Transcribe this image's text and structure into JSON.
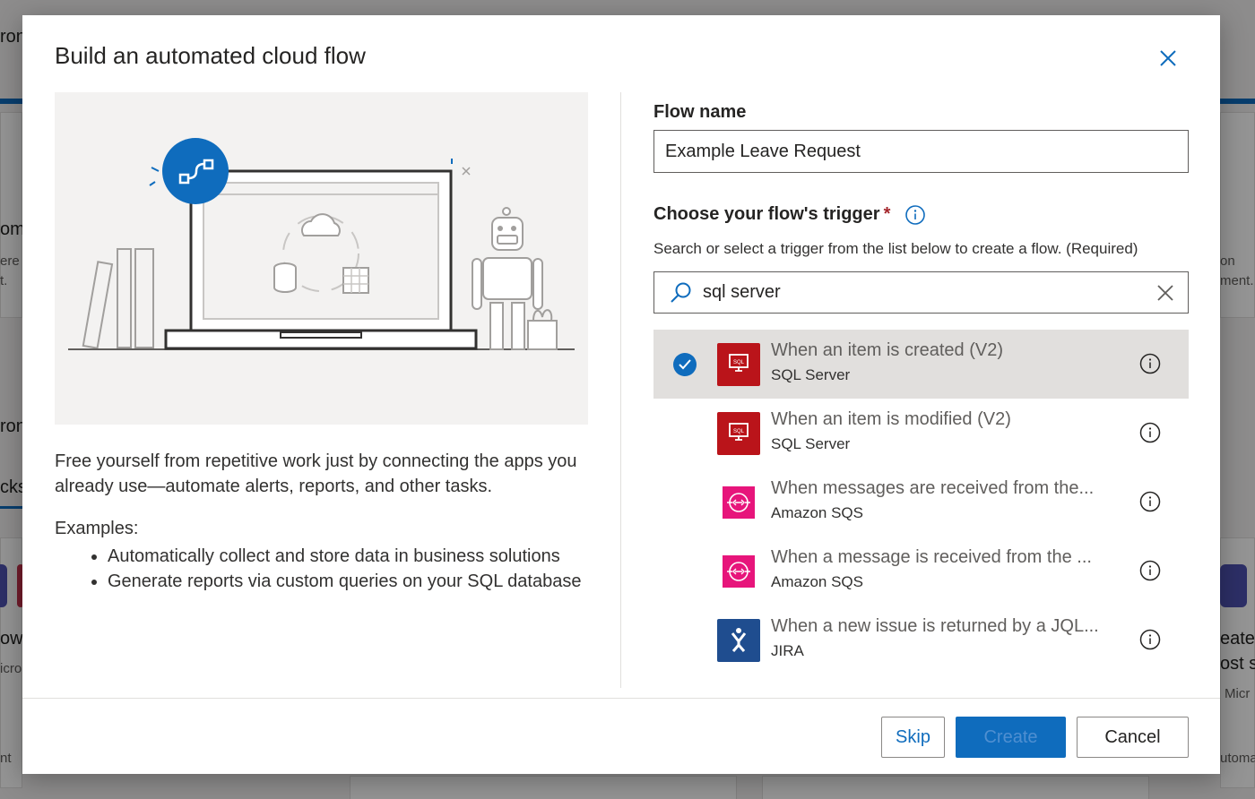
{
  "background": {
    "fragments": [
      "ron",
      "om",
      "ere",
      "t.",
      "ron",
      "cks",
      "ow",
      "icro",
      "nt",
      "on",
      "ment.",
      "eate",
      "ost s",
      "Micr",
      "utoma"
    ]
  },
  "modal": {
    "title": "Build an automated cloud flow",
    "description": "Free yourself from repetitive work just by connecting the apps you already use—automate alerts, reports, and other tasks.",
    "examples_label": "Examples:",
    "examples": [
      "Automatically collect and store data in business solutions",
      "Generate reports via custom queries on your SQL database"
    ],
    "flow_name": {
      "label": "Flow name",
      "value": "Example Leave Request"
    },
    "trigger": {
      "label": "Choose your flow's trigger",
      "required_mark": "*",
      "help": "Search or select a trigger from the list below to create a flow. (Required)",
      "search_value": "sql server",
      "items": [
        {
          "title": "When an item is created (V2)",
          "connector": "SQL Server",
          "icon": "sql-server-icon",
          "color": "#ba141a",
          "selected": true
        },
        {
          "title": "When an item is modified (V2)",
          "connector": "SQL Server",
          "icon": "sql-server-icon",
          "color": "#ba141a",
          "selected": false
        },
        {
          "title": "When messages are received from the...",
          "connector": "Amazon SQS",
          "icon": "amazon-sqs-icon",
          "color": "#e7157b",
          "selected": false
        },
        {
          "title": "When a message is received from the ...",
          "connector": "Amazon SQS",
          "icon": "amazon-sqs-icon",
          "color": "#e7157b",
          "selected": false
        },
        {
          "title": "When a new issue is returned by a JQL...",
          "connector": "JIRA",
          "icon": "jira-icon",
          "color": "#1f4d8f",
          "selected": false
        }
      ]
    },
    "buttons": {
      "skip": "Skip",
      "create": "Create",
      "cancel": "Cancel"
    }
  },
  "colors": {
    "accent": "#0f6cbd",
    "sql": "#ba141a",
    "sqs": "#e7157b",
    "jira": "#1f4d8f"
  }
}
